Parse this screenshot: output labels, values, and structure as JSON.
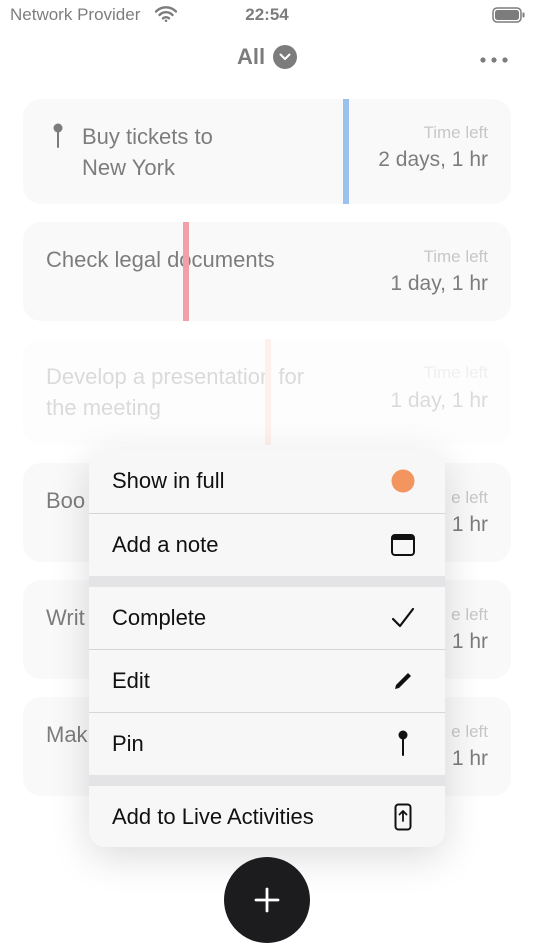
{
  "status_bar": {
    "carrier": "Network Provider",
    "time": "22:54"
  },
  "nav": {
    "title": "All"
  },
  "tasks": [
    {
      "title_lines": [
        "Buy tickets to",
        "New York"
      ],
      "time_label": "Time left",
      "time_value": "2 days, 1 hr",
      "marker_color": "#4a90e2",
      "pinned": true
    },
    {
      "title_lines": [
        "Check legal documents"
      ],
      "time_label": "Time left",
      "time_value": "1 day, 1 hr",
      "marker_color": "#e85262",
      "pinned": false
    },
    {
      "title_lines": [
        "Develop a presentation for",
        "the meeting"
      ],
      "time_label": "Time left",
      "time_value": "1 day, 1 hr",
      "marker_color": "#f3a48b",
      "pinned": false
    },
    {
      "title_lines": [
        "Boo"
      ],
      "time_label": "e left",
      "time_value": "1 hr"
    },
    {
      "title_lines": [
        "Writ"
      ],
      "time_label": "e left",
      "time_value": "1 hr"
    },
    {
      "title_lines": [
        "Mak"
      ],
      "time_label": "e left",
      "time_value": "1 hr"
    }
  ],
  "context_menu": {
    "items": [
      {
        "label": "Show in full",
        "icon": "orange-dot-icon"
      },
      {
        "label": "Add a note",
        "icon": "note-window-icon"
      },
      {
        "label": "Complete",
        "icon": "checkmark-icon"
      },
      {
        "label": "Edit",
        "icon": "pencil-icon"
      },
      {
        "label": "Pin",
        "icon": "pin-icon"
      },
      {
        "label": "Add to Live Activities",
        "icon": "live-activity-icon"
      }
    ]
  },
  "colors": {
    "accent_orange": "#f2955f",
    "fab": "#1c1c1e",
    "card_bg": "#f4f4f6"
  }
}
